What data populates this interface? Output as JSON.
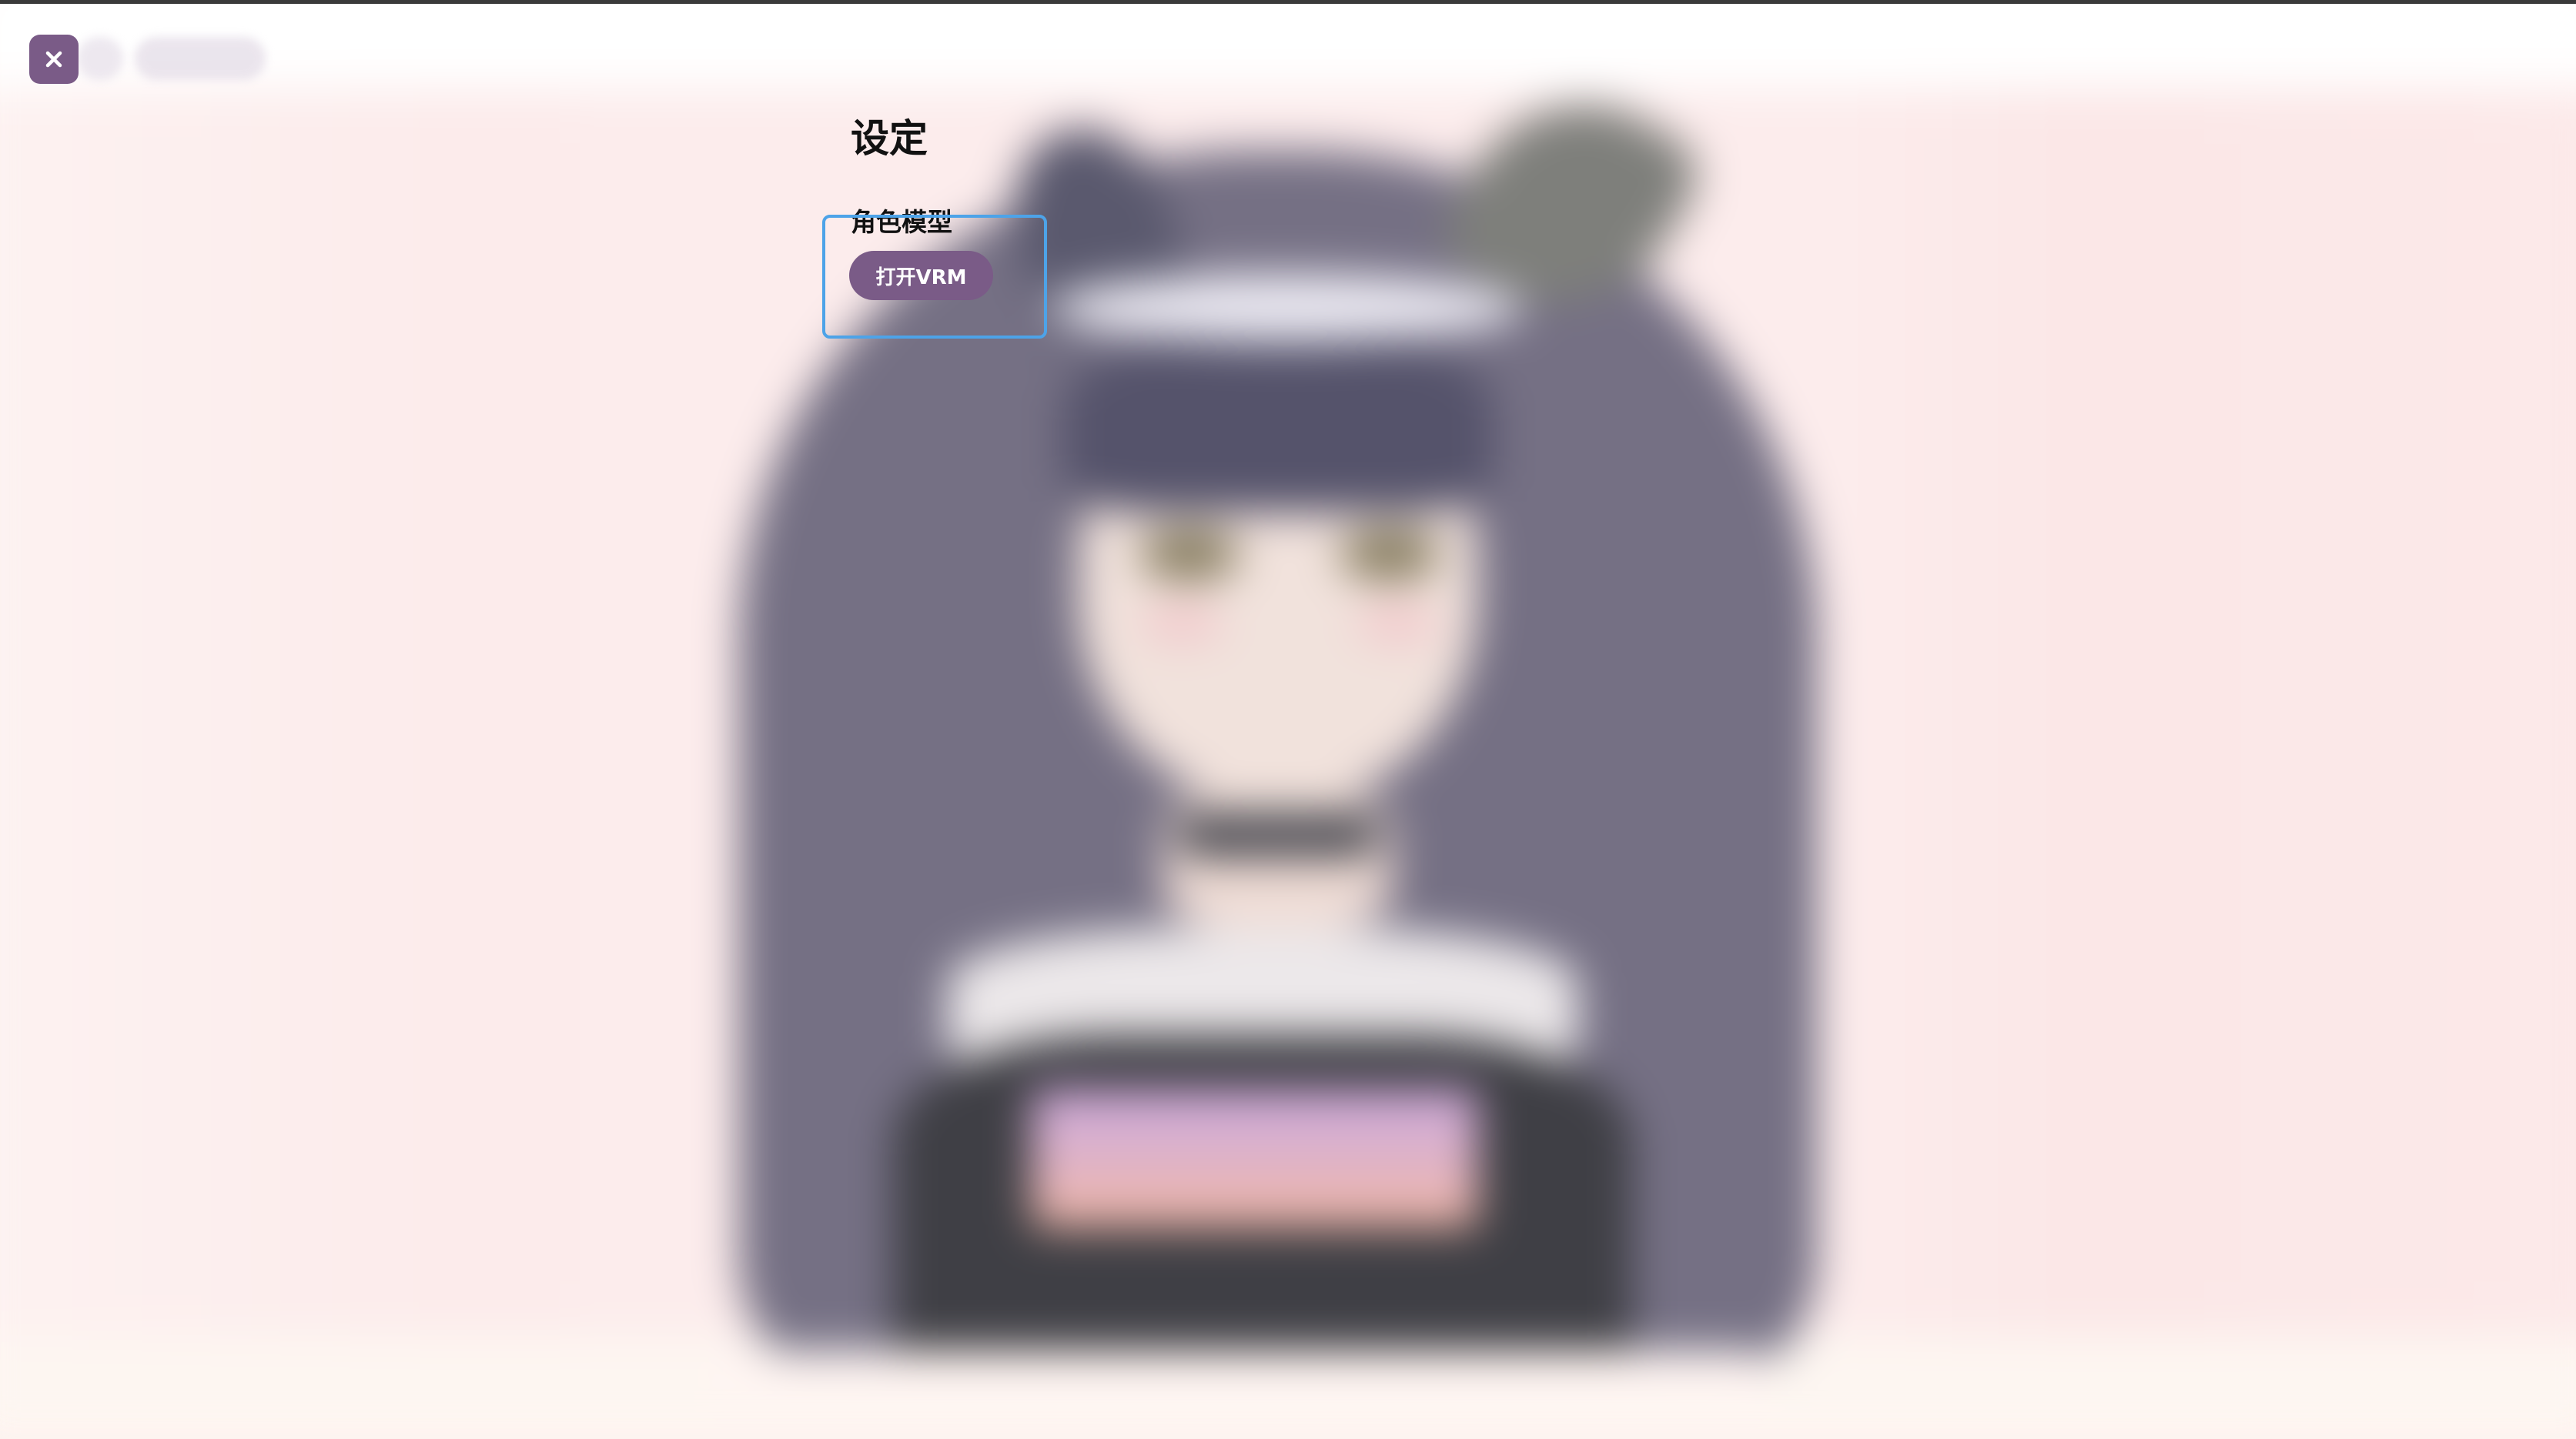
{
  "settings": {
    "title": "设定",
    "character_model": {
      "label": "角色模型",
      "open_vrm_button": "打开VRM"
    }
  },
  "controls": {
    "close_icon": "close-icon"
  },
  "colors": {
    "accent": "#7a5b87",
    "focus_ring": "#4da3e8",
    "background": "#fdf0ef"
  }
}
